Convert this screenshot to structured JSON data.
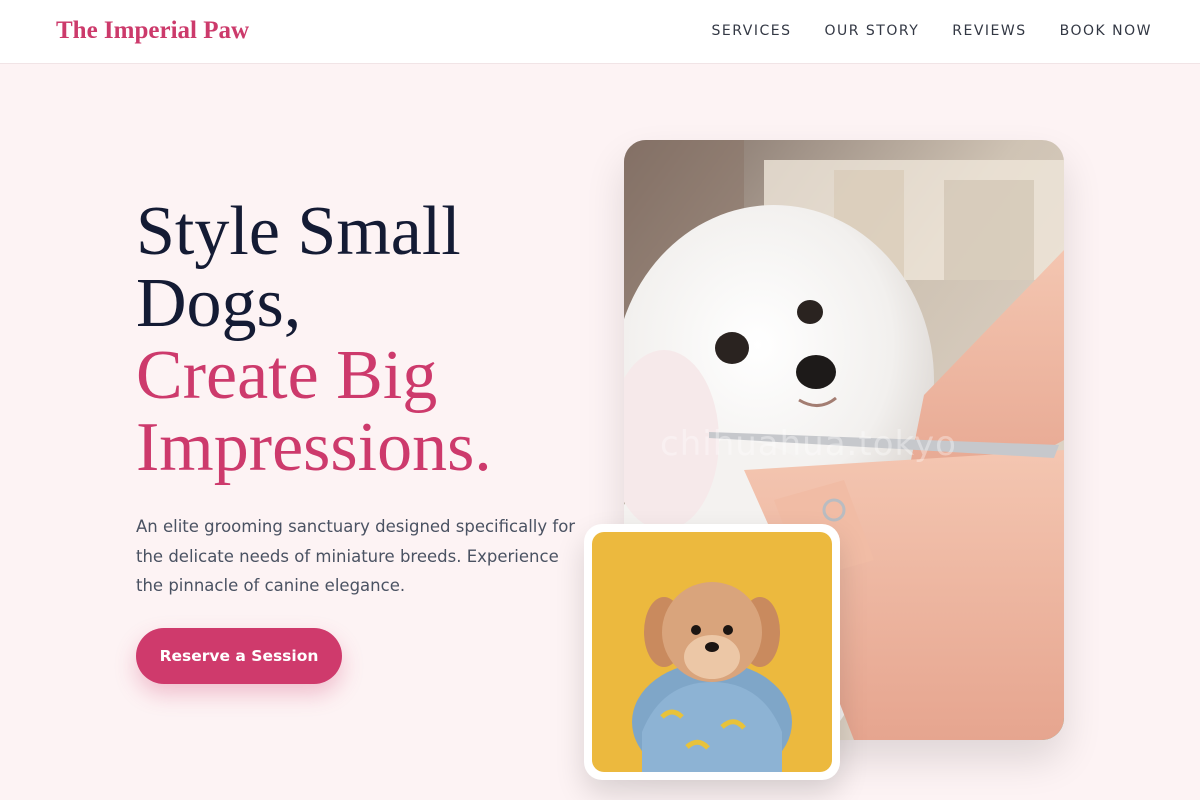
{
  "header": {
    "brand": "The Imperial Paw",
    "nav": [
      "SERVICES",
      "OUR STORY",
      "REVIEWS",
      "BOOK NOW"
    ]
  },
  "hero": {
    "headline_line1": "Style Small",
    "headline_line2": "Dogs,",
    "headline_accent1": "Create Big",
    "headline_accent2": "Impressions.",
    "subtext": "An elite grooming sanctuary designed specifically for the delicate needs of miniature breeds. Experience the pinnacle of canine elegance.",
    "cta_label": "Reserve a Session",
    "watermark": "chihuahua.tokyo"
  },
  "colors": {
    "accent": "#cd3a6c",
    "background": "#fdf3f4",
    "heading": "#141b34"
  }
}
